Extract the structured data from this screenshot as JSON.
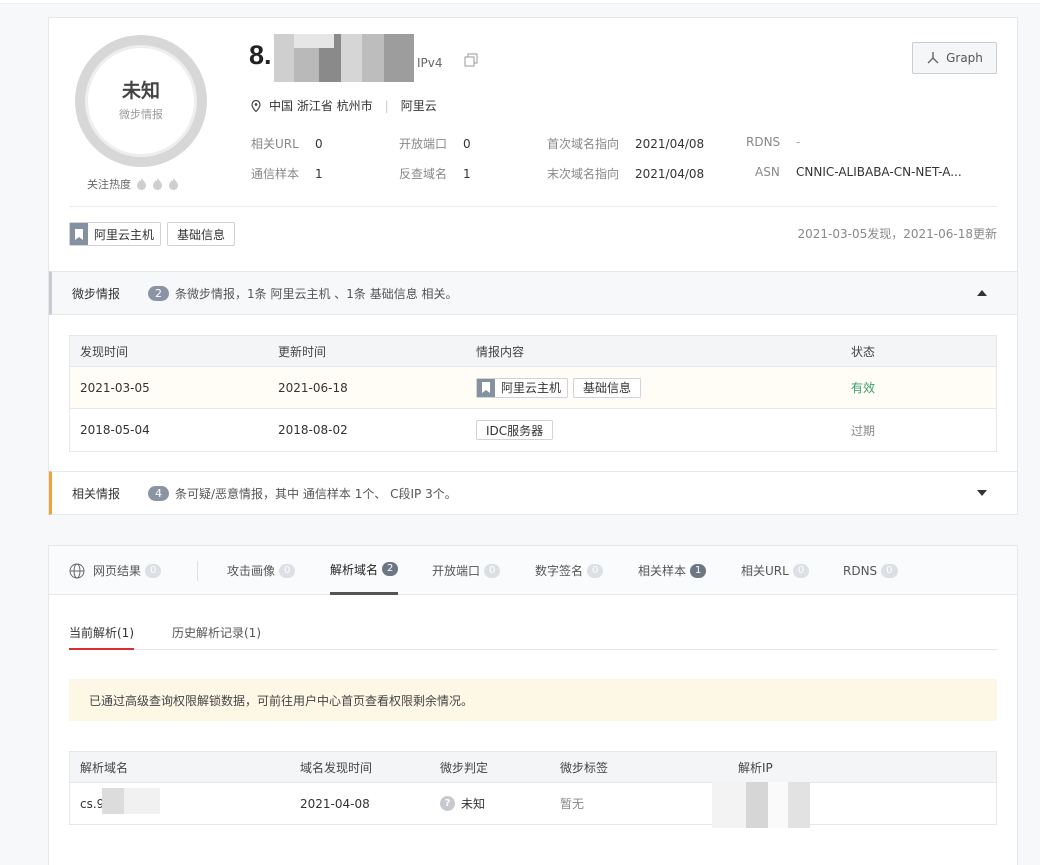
{
  "overview": {
    "verdict": "未知",
    "verdict_sub": "微步情报",
    "heat_label": "关注热度",
    "ip_prefix": "8.",
    "ip_type": "IPv4",
    "graph_label": "Graph",
    "location": "中国 浙江省 杭州市",
    "isp": "阿里云",
    "fields": {
      "related_url_k": "相关URL",
      "related_url_v": "0",
      "open_port_k": "开放端口",
      "open_port_v": "0",
      "first_dns_k": "首次域名指向",
      "first_dns_v": "2021/04/08",
      "rdns_k": "RDNS",
      "rdns_v": "-",
      "comm_sample_k": "通信样本",
      "comm_sample_v": "1",
      "reverse_domain_k": "反查域名",
      "reverse_domain_v": "1",
      "last_dns_k": "末次域名指向",
      "last_dns_v": "2021/04/08",
      "asn_k": "ASN",
      "asn_v": "CNNIC-ALIBABA-CN-NET-A..."
    },
    "tags": [
      "阿里云主机",
      "基础信息"
    ],
    "found_updated": "2021-03-05发现，2021-06-18更新"
  },
  "intel_section": {
    "label": "微步情报",
    "count": "2",
    "desc": "条微步情报，1条 阿里云主机 、1条 基础信息 相关。",
    "headers": [
      "发现时间",
      "更新时间",
      "情报内容",
      "状态"
    ],
    "rows": [
      {
        "found": "2021-03-05",
        "updated": "2021-06-18",
        "tag1": "阿里云主机",
        "tag2": "基础信息",
        "status": "有效"
      },
      {
        "found": "2018-05-04",
        "updated": "2018-08-02",
        "tag1": "IDC服务器",
        "status": "过期"
      }
    ]
  },
  "related_section": {
    "label": "相关情报",
    "count": "4",
    "desc": "条可疑/恶意情报，其中 通信样本 1个、 C段IP 3个。"
  },
  "tabs": [
    {
      "label": "网页结果",
      "count": "0"
    },
    {
      "label": "攻击画像",
      "count": "0"
    },
    {
      "label": "解析域名",
      "count": "2"
    },
    {
      "label": "开放端口",
      "count": "0"
    },
    {
      "label": "数字签名",
      "count": "0"
    },
    {
      "label": "相关样本",
      "count": "1"
    },
    {
      "label": "相关URL",
      "count": "0"
    },
    {
      "label": "RDNS",
      "count": "0"
    }
  ],
  "subtabs": [
    "当前解析(1)",
    "历史解析记录(1)"
  ],
  "notice": "已通过高级查询权限解锁数据，可前往用户中心首页查看权限剩余情况。",
  "dns_table": {
    "headers": [
      "解析域名",
      "域名发现时间",
      "微步判定",
      "微步标签",
      "解析IP"
    ],
    "rows": [
      {
        "domain": "cs.9",
        "found": "2021-04-08",
        "verdict": "未知",
        "tags": "暂无"
      }
    ]
  }
}
